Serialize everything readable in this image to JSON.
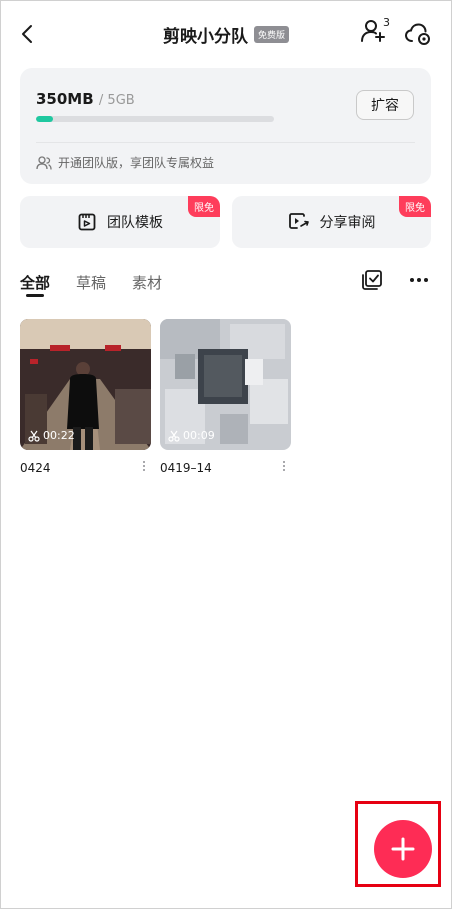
{
  "header": {
    "title": "剪映小分队",
    "free_badge": "免费版",
    "member_count": "3"
  },
  "storage": {
    "used": "350MB",
    "total": "/ 5GB",
    "expand_label": "扩容",
    "promo": "开通团队版，享团队专属权益",
    "used_fraction": 0.07,
    "accent_color": "#1fc8a0"
  },
  "features": [
    {
      "label": "团队模板",
      "badge": "限免"
    },
    {
      "label": "分享审阅",
      "badge": "限免"
    }
  ],
  "tabs": [
    {
      "label": "全部",
      "active": true
    },
    {
      "label": "草稿",
      "active": false
    },
    {
      "label": "素材",
      "active": false
    }
  ],
  "items": [
    {
      "name": "0424",
      "duration": "00:22"
    },
    {
      "name": "0419–14",
      "duration": "00:09"
    }
  ],
  "fab": {
    "color": "#fe2c55"
  }
}
